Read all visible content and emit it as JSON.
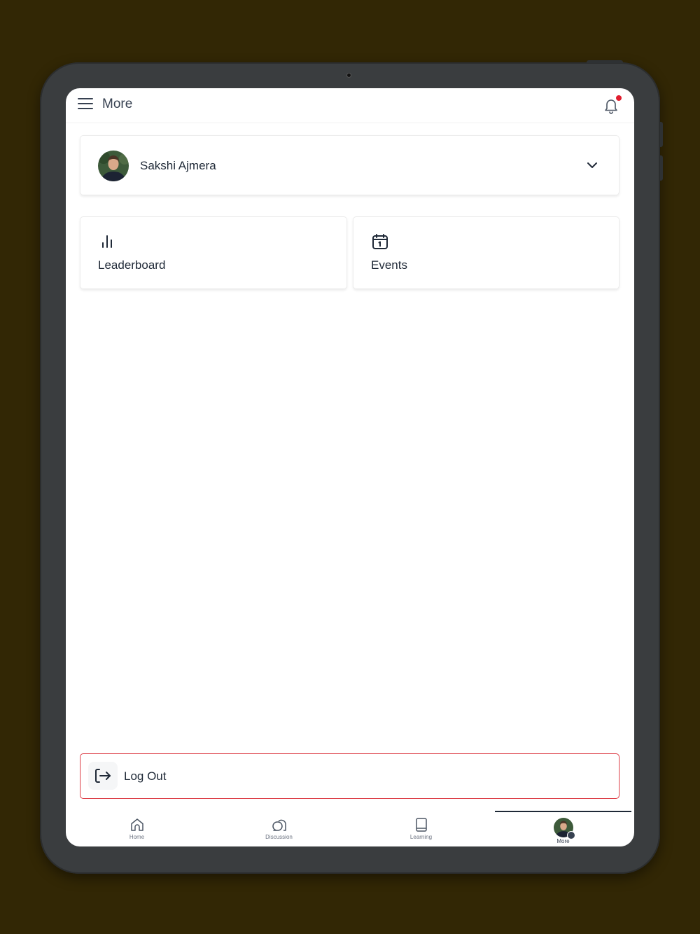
{
  "header": {
    "title": "More",
    "has_notification": true
  },
  "profile": {
    "name": "Sakshi Ajmera"
  },
  "tiles": [
    {
      "label": "Leaderboard",
      "icon": "bar-chart-icon"
    },
    {
      "label": "Events",
      "icon": "calendar-icon"
    }
  ],
  "logout": {
    "label": "Log Out",
    "icon": "logout-icon"
  },
  "nav": {
    "items": [
      {
        "label": "Home",
        "icon": "home-icon"
      },
      {
        "label": "Discussion",
        "icon": "discussion-icon"
      },
      {
        "label": "Learning",
        "icon": "book-icon"
      },
      {
        "label": "More",
        "icon": "avatar",
        "active": true
      }
    ]
  },
  "colors": {
    "background": "#322705",
    "accent_danger": "#dc3c45",
    "notification_dot": "#e11d2e",
    "text_primary": "#1f2937"
  }
}
